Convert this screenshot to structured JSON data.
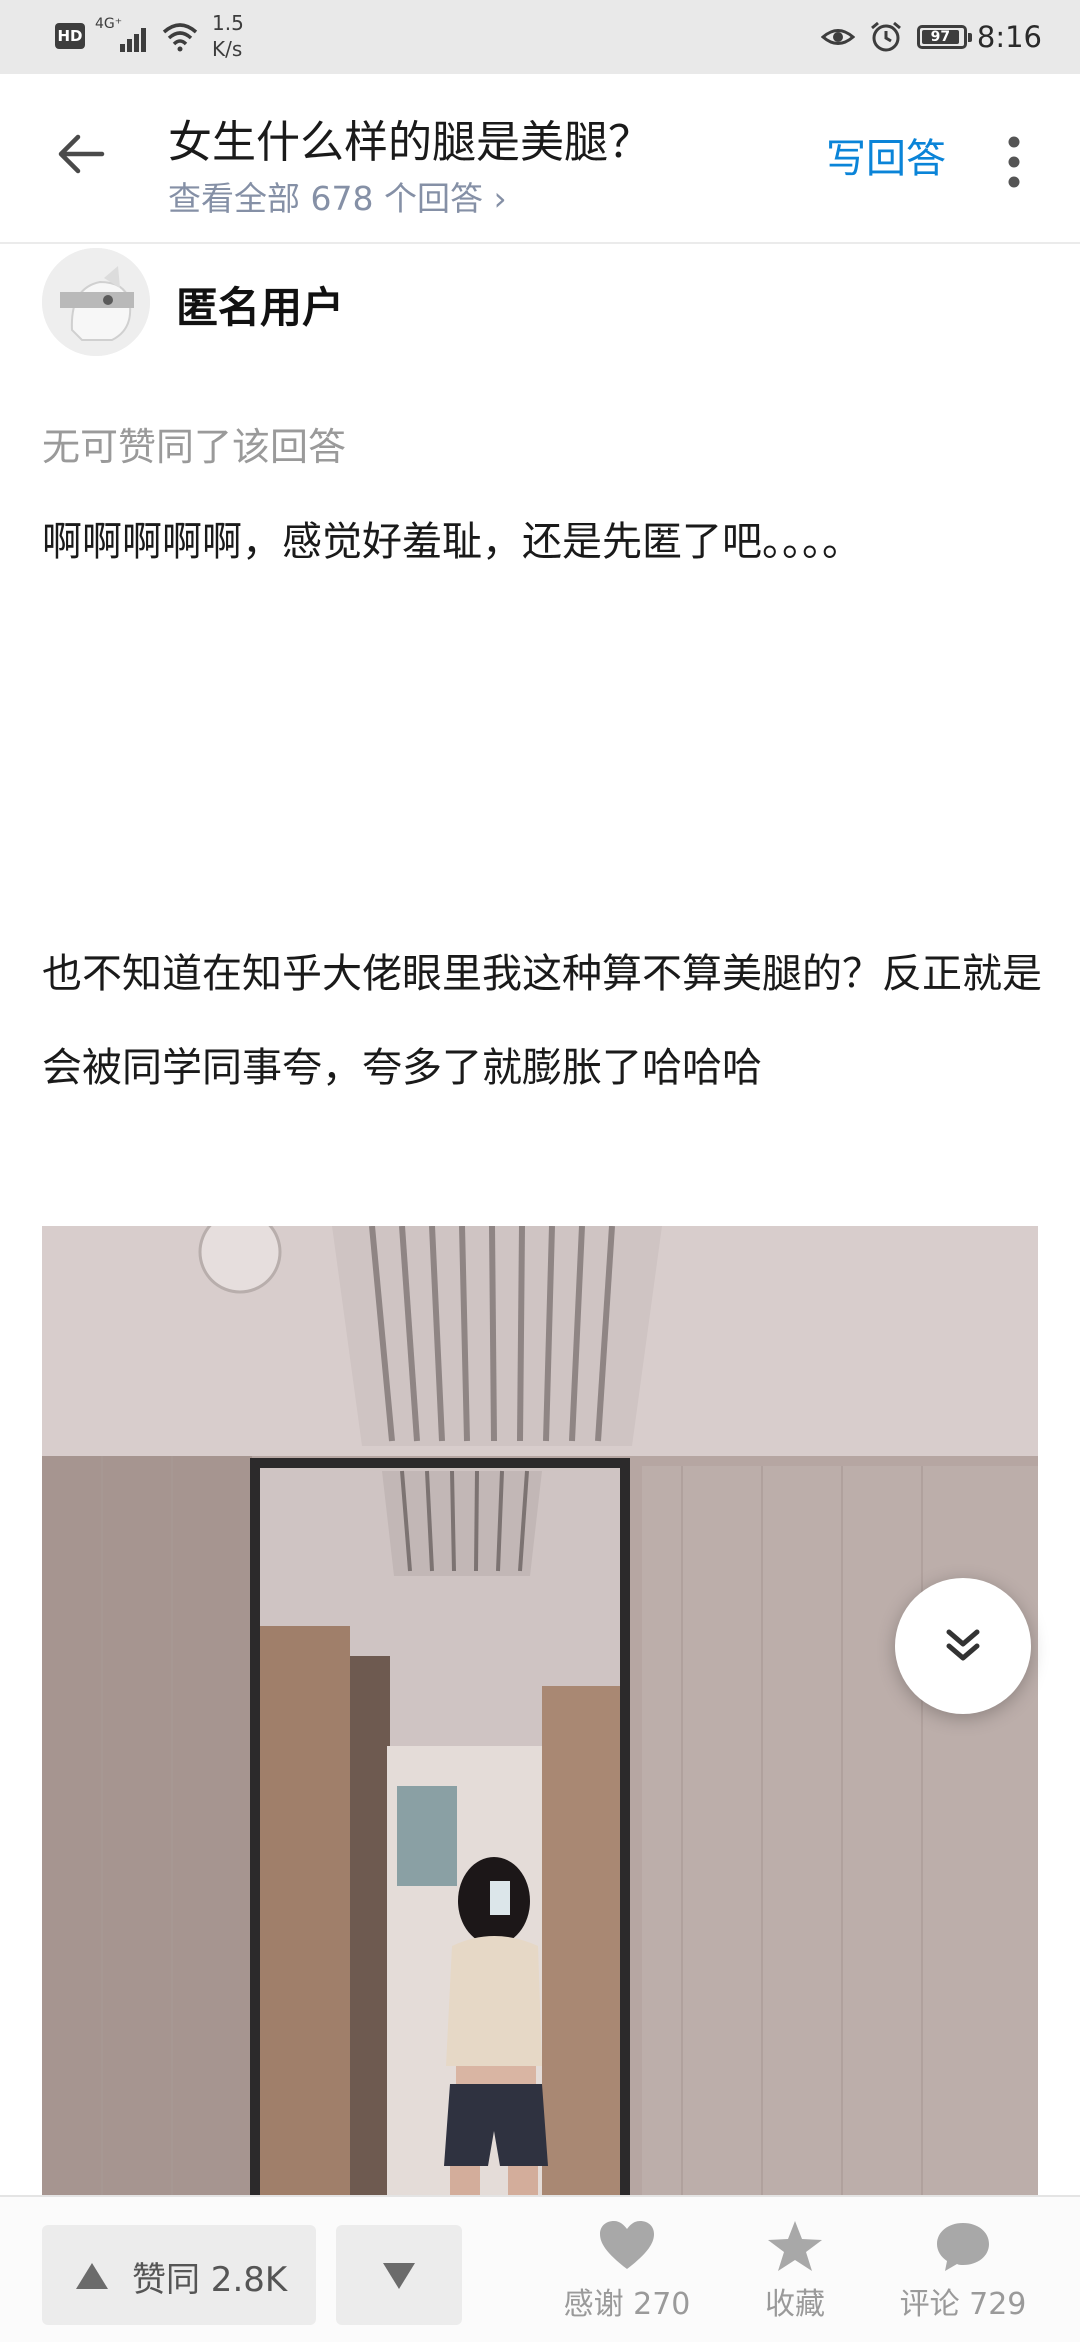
{
  "status_bar": {
    "hd": "HD",
    "network": "4G⁺",
    "speed_value": "1.5",
    "speed_unit": "K/s",
    "battery": "97",
    "time": "8:16"
  },
  "header": {
    "title": "女生什么样的腿是美腿？",
    "subtitle": "查看全部 678 个回答 ›",
    "write_answer": "写回答"
  },
  "answer": {
    "author": "匿名用户",
    "upvoted_by": "无可赞同了该回答",
    "paragraph1": "啊啊啊啊啊，感觉好羞耻，还是先匿了吧。。。。",
    "paragraph2": "也不知道在知乎大佬眼里我这种算不算美腿的？反正就是会被同学同事夸，夸多了就膨胀了哈哈哈"
  },
  "actions": {
    "upvote": "赞同 2.8K",
    "thanks": "感谢 270",
    "collect": "收藏",
    "comment": "评论 729"
  },
  "colors": {
    "accent": "#0a84d8",
    "muted": "#8590a6",
    "icon_gray": "#a8a8a8"
  }
}
